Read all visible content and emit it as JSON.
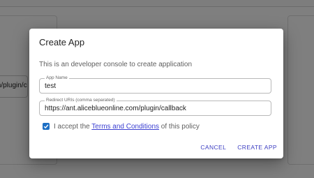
{
  "background": {
    "field_value": "m/plugin/ca"
  },
  "dialog": {
    "title": "Create App",
    "description": "This is an developer console to create application",
    "app_name": {
      "label": "App Name",
      "value": "test"
    },
    "redirect_uris": {
      "label": "Redirect URIs (comma separated)",
      "value": "https://ant.aliceblueonline.com/plugin/callback"
    },
    "consent": {
      "checked": true,
      "prefix": "I accept the ",
      "link_text": "Terms and Conditions",
      "suffix": " of this policy"
    },
    "cancel_label": "CANCEL",
    "create_label": "CREATE APP"
  },
  "colors": {
    "accent": "#3d3fc2",
    "checkbox": "#1d6fc4"
  }
}
